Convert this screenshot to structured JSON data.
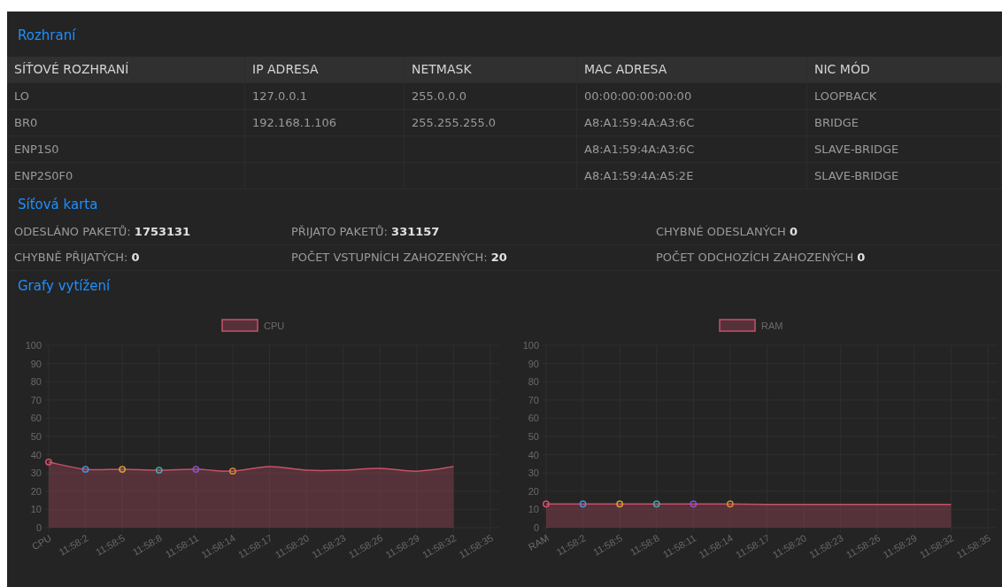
{
  "interfaces": {
    "title": "Rozhraní",
    "columns": [
      "SÍŤOVÉ ROZHRANÍ",
      "IP ADRESA",
      "NETMASK",
      "MAC ADRESA",
      "NIC MÓD"
    ],
    "rows": [
      [
        "LO",
        "127.0.0.1",
        "255.0.0.0",
        "00:00:00:00:00:00",
        "LOOPBACK"
      ],
      [
        "BR0",
        "192.168.1.106",
        "255.255.255.0",
        "A8:A1:59:4A:A3:6C",
        "BRIDGE"
      ],
      [
        "ENP1S0",
        "",
        "",
        "A8:A1:59:4A:A3:6C",
        "SLAVE-BRIDGE"
      ],
      [
        "ENP2S0F0",
        "",
        "",
        "A8:A1:59:4A:A5:2E",
        "SLAVE-BRIDGE"
      ]
    ]
  },
  "network_card": {
    "title": "Síťová karta",
    "stats": [
      {
        "label": "ODESLÁNO PAKETŮ:",
        "value": "1753131"
      },
      {
        "label": "PŘIJATO PAKETŮ:",
        "value": "331157"
      },
      {
        "label": "CHYBNÉ ODESLANÝCH",
        "value": "0"
      },
      {
        "label": "CHYBNĚ PŘIJATÝCH:",
        "value": "0"
      },
      {
        "label": "POČET VSTUPNÍCH ZAHOZENÝCH:",
        "value": "20"
      },
      {
        "label": "POČET ODCHOZÍCH ZAHOZENÝCH",
        "value": "0"
      }
    ]
  },
  "charts": {
    "title": "Grafy vytížení",
    "items": [
      {
        "chart_data": {
          "type": "area",
          "categories": [
            "CPU",
            "11:58:2",
            "11:58:5",
            "11:58:8",
            "11:58:11",
            "11:58:14",
            "11:58:17",
            "11:58:20",
            "11:58:23",
            "11:58:26",
            "11:58:29",
            "11:58:32",
            "11:58:35"
          ],
          "ylim": [
            0,
            100
          ],
          "yticks": [
            0,
            10,
            20,
            30,
            40,
            50,
            60,
            70,
            80,
            90,
            100
          ],
          "grid": true,
          "series": [
            {
              "name": "CPU",
              "color": "#c8506a",
              "values": [
                36,
                32,
                32,
                31.5,
                32,
                31,
                33.5,
                31.5,
                31.5,
                32.5,
                31,
                33.5,
                null
              ]
            }
          ]
        }
      },
      {
        "chart_data": {
          "type": "area",
          "categories": [
            "RAM",
            "11:58:2",
            "11:58:5",
            "11:58:8",
            "11:58:11",
            "11:58:14",
            "11:58:17",
            "11:58:20",
            "11:58:23",
            "11:58:26",
            "11:58:29",
            "11:58:32",
            "11:58:35"
          ],
          "ylim": [
            0,
            100
          ],
          "yticks": [
            0,
            10,
            20,
            30,
            40,
            50,
            60,
            70,
            80,
            90,
            100
          ],
          "grid": true,
          "series": [
            {
              "name": "RAM",
              "color": "#c8506a",
              "values": [
                13,
                13,
                13,
                13,
                13,
                13,
                12.8,
                12.8,
                12.8,
                12.8,
                12.8,
                12.8,
                null
              ]
            }
          ]
        }
      }
    ]
  }
}
